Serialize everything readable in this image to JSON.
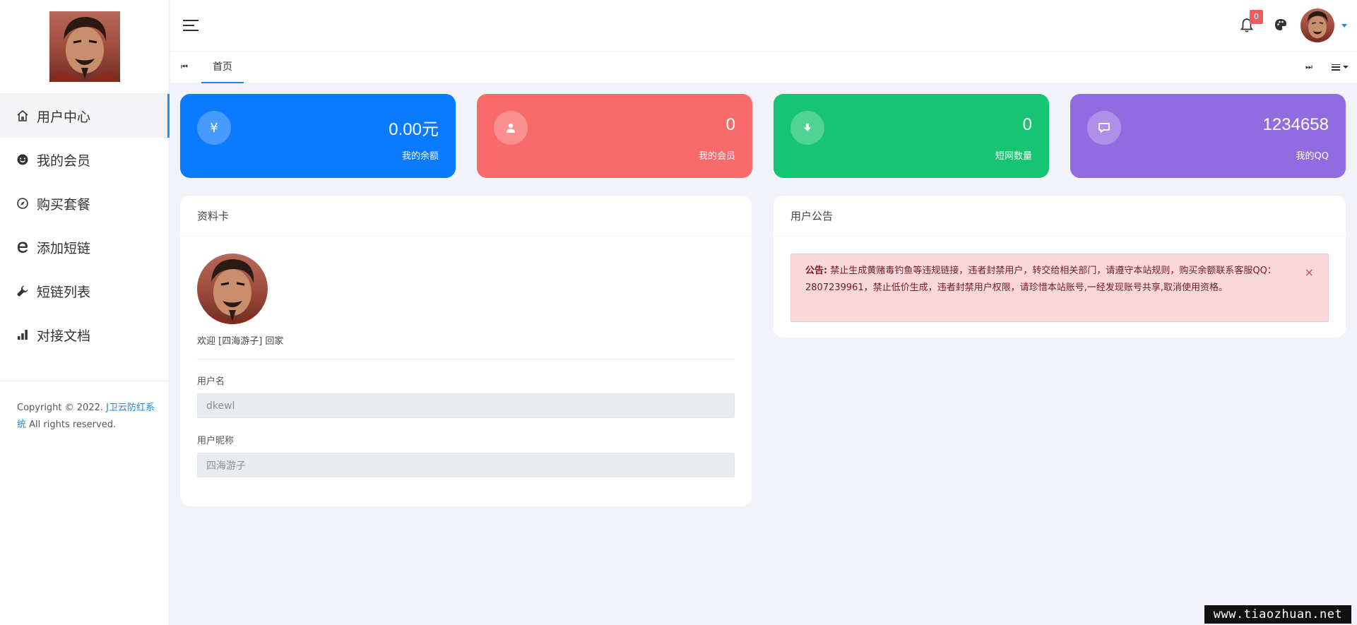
{
  "sidebar": {
    "items": [
      {
        "label": "用户中心",
        "icon": "home-icon"
      },
      {
        "label": "我的会员",
        "icon": "smile-icon"
      },
      {
        "label": "购买套餐",
        "icon": "compass-icon"
      },
      {
        "label": "添加短链",
        "icon": "ie-icon"
      },
      {
        "label": "短链列表",
        "icon": "wrench-icon"
      },
      {
        "label": "对接文档",
        "icon": "signal-icon"
      }
    ],
    "copyright_prefix": "Copyright © 2022.",
    "copyright_link": "J卫云防红系统",
    "copyright_suffix": "All rights reserved."
  },
  "header": {
    "notification_count": "0"
  },
  "tabs": {
    "prev": "⏮",
    "next": "⏭",
    "items": [
      {
        "label": "首页"
      }
    ]
  },
  "stats": [
    {
      "icon": "¥",
      "value": "0.00元",
      "label": "我的余额",
      "color": "#0a7afe"
    },
    {
      "icon": "user",
      "value": "0",
      "label": "我的会员",
      "color": "#f96b6b"
    },
    {
      "icon": "download",
      "value": "0",
      "label": "短网数量",
      "color": "#17c471"
    },
    {
      "icon": "comment",
      "value": "1234658",
      "label": "我的QQ",
      "color": "#936be0"
    }
  ],
  "profile": {
    "title": "资料卡",
    "welcome": "欢迎 [四海游子] 回家",
    "username_label": "用户名",
    "username_value": "dkewl",
    "nickname_label": "用户昵称",
    "nickname_value": "四海游子"
  },
  "announcement": {
    "title": "用户公告",
    "prefix": "公告:",
    "text": "禁止生成黄赌毒钓鱼等违规链接，违者封禁用户，转交给相关部门，请遵守本站规则，购买余额联系客服QQ：2807239961，禁止低价生成，违者封禁用户权限，请珍惜本站账号,一经发现账号共享,取消使用资格。",
    "close": "×"
  },
  "watermark": "www.tiaozhuan.net"
}
